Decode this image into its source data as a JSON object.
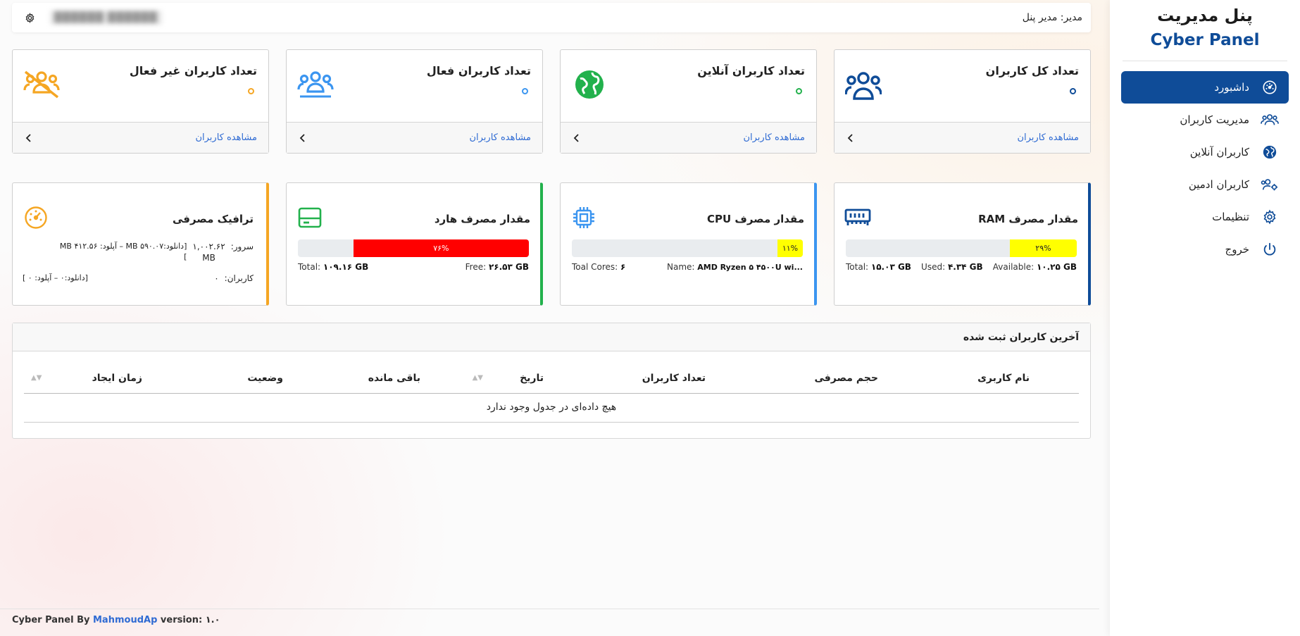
{
  "sidebar": {
    "title": "پنل مدیریت",
    "subtitle": "Cyber Panel",
    "items": [
      {
        "label": "داشبورد",
        "icon": "dashboard-icon",
        "active": true
      },
      {
        "label": "مدیریت کاربران",
        "icon": "users-icon"
      },
      {
        "label": "کاربران آنلاین",
        "icon": "globe-icon"
      },
      {
        "label": "کاربران ادمین",
        "icon": "admin-users-icon"
      },
      {
        "label": "تنظیمات",
        "icon": "gear-icon"
      },
      {
        "label": "خروج",
        "icon": "power-icon"
      }
    ]
  },
  "topbar": {
    "admin_label": "مدیر: مدیر پنل",
    "redacted_name": "██████ ██████"
  },
  "cards": [
    {
      "title": "تعداد کل کاربران",
      "link": "مشاهده کاربران",
      "color": "#0f4c98",
      "icon": "users-group-icon"
    },
    {
      "title": "تعداد کاربران آنلاین",
      "link": "مشاهده کاربران",
      "color": "#22b14c",
      "icon": "globe-icon"
    },
    {
      "title": "تعداد کاربران فعال",
      "link": "مشاهده کاربران",
      "color": "#3b95f0",
      "icon": "users-active-icon"
    },
    {
      "title": "تعداد کاربران غیر فعال",
      "link": "مشاهده کاربران",
      "color": "#f5a623",
      "icon": "users-slash-icon"
    }
  ],
  "ram": {
    "title": "مقدار مصرف RAM",
    "percent_label": "۲۹%",
    "total_label": "Total:",
    "total": "۱۵.۰۳ GB",
    "used_label": "Used:",
    "used": "۴.۳۴ GB",
    "available_label": "Available:",
    "available": "۱۰.۲۵ GB",
    "bar_color": "#ffff00",
    "accent": "#0f4c98"
  },
  "cpu": {
    "title": "مقدار مصرف CPU",
    "percent_label": "۱۱%",
    "cores_label": "Toal Cores:",
    "cores": "۶",
    "name_label": "Name:",
    "name": "AMD Ryzen ۵ ۴۵۰۰U wi...",
    "bar_color": "#ffff00",
    "accent": "#3b95f0"
  },
  "disk": {
    "title": "مقدار مصرف هارد",
    "percent_label": "۷۶%",
    "total_label": "Total:",
    "total": "۱۰۹.۱۶ GB",
    "free_label": "Free:",
    "free": "۲۶.۵۳ GB",
    "bar_color": "#ff0000",
    "accent": "#22b14c"
  },
  "traffic": {
    "title": "ترافیک مصرفی",
    "server_label": "سرور:",
    "server_value": "۱,۰۰۲.۶۲",
    "server_unit": "MB",
    "server_detail": "[دانلود:MB ۵۹۰.۰۷ – آپلود: ۴۱۲.۵۶ MB",
    "server_detail_end": "]",
    "users_label": "کاربران:",
    "users_value": "۰",
    "users_detail": "[دانلود:۰ – آپلود: ۰ ]",
    "accent": "#f5a623"
  },
  "table": {
    "title": "آخرین کاربران ثبت شده",
    "columns": [
      "نام کاربری",
      "حجم مصرفی",
      "تعداد کاربران",
      "تاریخ",
      "باقی مانده",
      "وضعیت",
      "زمان ایجاد"
    ],
    "empty_text": "هیچ داده‌ای در جدول وجود ندارد"
  },
  "footer": {
    "prefix": "Cyber Panel By",
    "author": "MahmoudAp",
    "version": "version: ۱.۰"
  }
}
